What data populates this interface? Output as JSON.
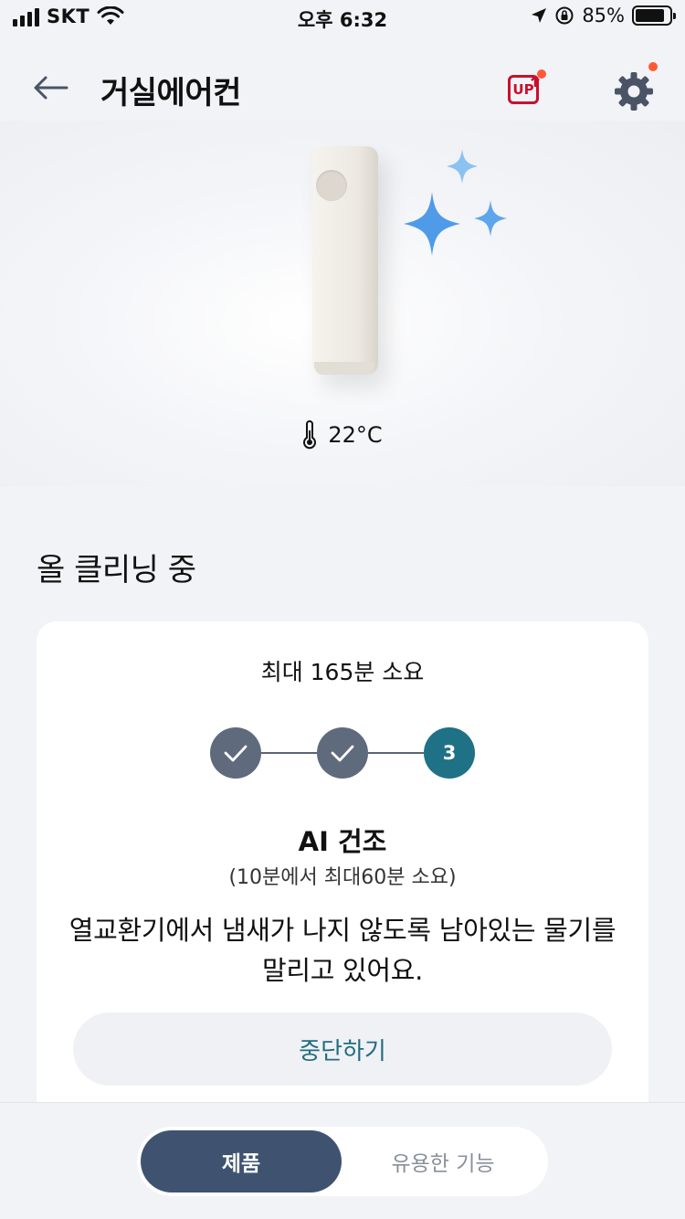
{
  "status_bar": {
    "carrier": "SKT",
    "time": "오후 6:32",
    "battery_percent": "85%",
    "battery_level": 0.85,
    "icons": [
      "signal-icon",
      "wifi-icon",
      "location-icon",
      "orientation-lock-icon",
      "battery-icon"
    ]
  },
  "header": {
    "title": "거실에어컨",
    "up_label": "UP",
    "back_icon": "back-arrow-icon",
    "settings_icon": "gear-icon",
    "notification_color": "#ff5a36",
    "up_color": "#c8102e"
  },
  "hero": {
    "temperature": "22°C",
    "temperature_icon": "thermometer-icon",
    "sparkle_color": "#4f9be8"
  },
  "cleaning": {
    "section_title": "올 클리닝 중",
    "duration": "최대 165분 소요",
    "steps": [
      {
        "state": "done",
        "label": ""
      },
      {
        "state": "done",
        "label": ""
      },
      {
        "state": "active",
        "label": "3"
      }
    ],
    "step_title": "AI 건조",
    "step_subtitle": "(10분에서 최대60분 소요)",
    "description": "열교환기에서 냄새가 나지 않도록 남아있는 물기를 말리고 있어요.",
    "stop_button": "중단하기",
    "active_color": "#1f7186",
    "done_color": "#5f6a7d"
  },
  "bottom_nav": {
    "tabs": [
      {
        "label": "제품",
        "active": true
      },
      {
        "label": "유용한 기능",
        "active": false
      }
    ],
    "active_color": "#3f5371"
  }
}
